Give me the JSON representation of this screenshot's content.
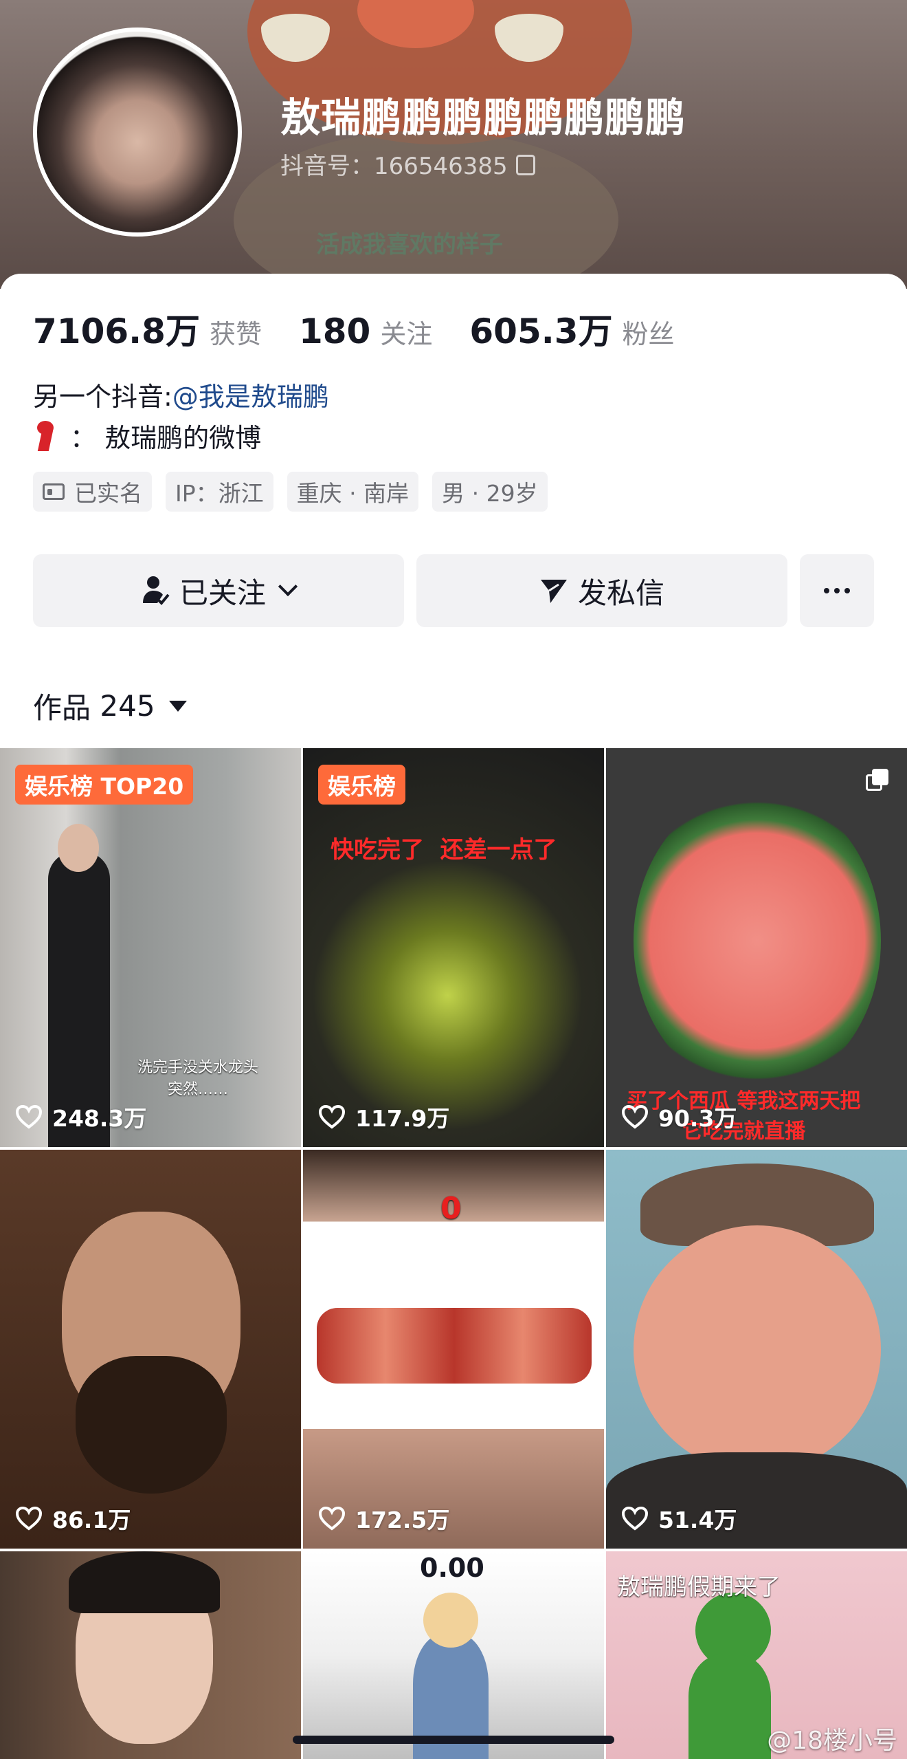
{
  "profile": {
    "nickname": "敖瑞鹏鹏鹏鹏鹏鹏鹏鹏",
    "douyin_id": "抖音号：166546385",
    "slogan": "活成我喜欢的样子"
  },
  "stats": {
    "likes_value": "7106.8万",
    "likes_label": "获赞",
    "following_value": "180",
    "following_label": "关注",
    "followers_value": "605.3万",
    "followers_label": "粉丝"
  },
  "bio": {
    "line1_prefix": "另一个抖音:",
    "line1_link": "@我是敖瑞鹏",
    "line2": "：  敖瑞鹏的微博"
  },
  "tags": [
    "已实名",
    "IP：浙江",
    "重庆 · 南岸",
    "男 · 29岁"
  ],
  "buttons": {
    "follow": "已关注",
    "message": "发私信"
  },
  "works": {
    "label": "作品",
    "count": "245"
  },
  "videos": [
    {
      "likes": "248.3万",
      "badge": "娱乐榜 TOP20",
      "caption": "洗完手没关水龙头\n突然……"
    },
    {
      "likes": "117.9万",
      "badge": "娱乐榜",
      "caption": "快吃完了  还差一点了"
    },
    {
      "likes": "90.3万",
      "caption": "买了个西瓜 等我这两天把\n它吃完就直播"
    },
    {
      "likes": "86.1万"
    },
    {
      "likes": "172.5万",
      "caption": "0"
    },
    {
      "likes": "51.4万"
    },
    {
      "caption": ""
    },
    {
      "caption": "0.00"
    },
    {
      "caption": "敖瑞鹏假期来了"
    }
  ],
  "watermark": "@18楼小号",
  "colors": {
    "badge": "#fe6a3a",
    "link": "#1f4a8c",
    "button_bg": "#f2f2f4"
  }
}
